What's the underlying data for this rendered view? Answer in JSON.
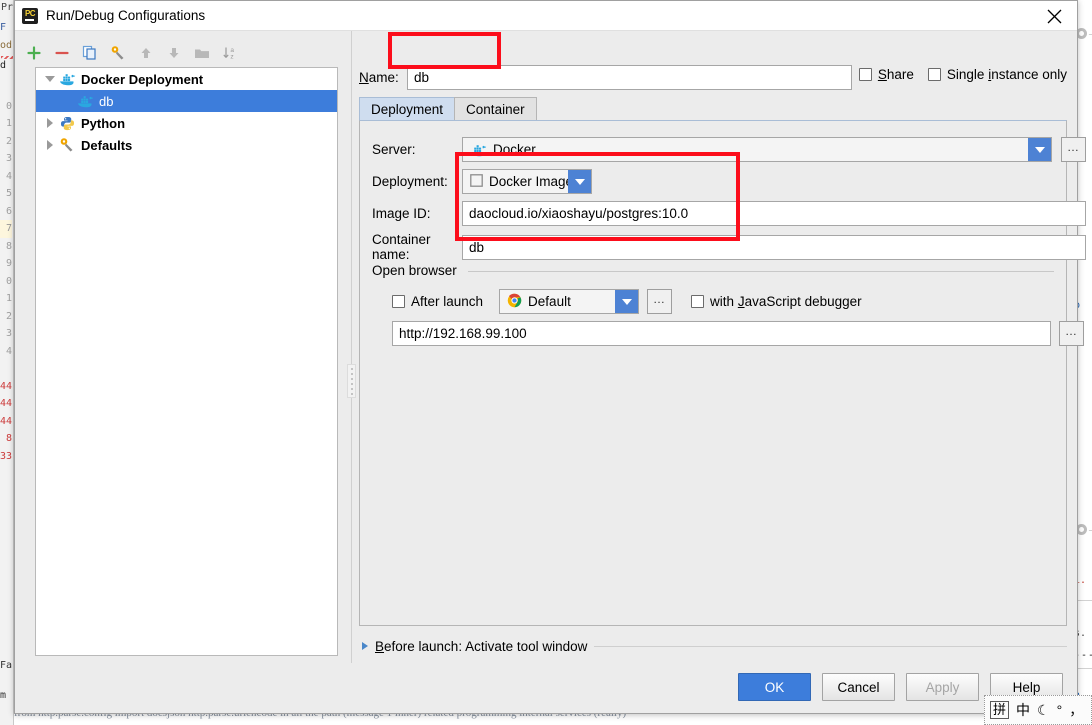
{
  "window": {
    "title": "Run/Debug Configurations",
    "app_icon": "pycharm-icon",
    "close_icon": "close-icon"
  },
  "toolbar": {
    "buttons": [
      {
        "name": "add-configuration",
        "icon": "plus-icon",
        "label": "+"
      },
      {
        "name": "remove-configuration",
        "icon": "minus-icon",
        "label": "−"
      },
      {
        "name": "copy-configuration",
        "icon": "copy-icon",
        "label": ""
      },
      {
        "name": "edit-templates",
        "icon": "wrench-icon",
        "label": ""
      },
      {
        "name": "move-up",
        "icon": "arrow-up-icon",
        "label": ""
      },
      {
        "name": "move-down",
        "icon": "arrow-down-icon",
        "label": ""
      },
      {
        "name": "move-into-folder",
        "icon": "folder-icon",
        "label": ""
      },
      {
        "name": "sort-configurations",
        "icon": "sort-az-icon",
        "label": ""
      }
    ]
  },
  "tree": {
    "items": [
      {
        "label": "Docker Deployment",
        "icon": "docker-icon",
        "expanded": true,
        "depth": 0,
        "selected": false,
        "twisty": "down"
      },
      {
        "label": "db",
        "icon": "docker-icon",
        "expanded": false,
        "depth": 1,
        "selected": true,
        "twisty": "none"
      },
      {
        "label": "Python",
        "icon": "python-icon",
        "expanded": false,
        "depth": 0,
        "selected": false,
        "twisty": "right"
      },
      {
        "label": "Defaults",
        "icon": "wrench-icon",
        "expanded": false,
        "depth": 0,
        "selected": false,
        "twisty": "right"
      }
    ]
  },
  "form": {
    "name_label": "Name:",
    "name_label_mnemonic": "N",
    "name_value": "db",
    "share": {
      "label": "Share",
      "mnemonic": "S",
      "checked": false
    },
    "single_instance": {
      "label": "Single instance only",
      "mnemonic": "i",
      "checked": false
    },
    "tabs": [
      {
        "label": "Deployment",
        "active": true
      },
      {
        "label": "Container",
        "active": false
      }
    ],
    "server": {
      "label": "Server:",
      "value": "Docker",
      "icon": "docker-icon",
      "dropdown_icon": "chevron-down-icon",
      "browse_label": "…"
    },
    "deployment": {
      "label": "Deployment:",
      "value": "Docker Image",
      "icon": "image-icon",
      "dropdown_icon": "chevron-down-icon"
    },
    "image_id": {
      "label": "Image ID:",
      "value": "daocloud.io/xiaoshayu/postgres:10.0"
    },
    "container_name": {
      "label": "Container name:",
      "value": "db"
    },
    "open_browser": {
      "group_label": "Open browser",
      "after_launch": {
        "label": "After launch",
        "checked": false
      },
      "browser": {
        "value": "Default",
        "icon": "chrome-icon",
        "dropdown_icon": "chevron-down-icon",
        "browse_label": "…"
      },
      "js_debugger": {
        "label": "with JavaScript debugger",
        "mnemonic": "J",
        "checked": false
      },
      "url": {
        "value": "http://192.168.99.100",
        "browse_label": "…"
      }
    },
    "before_launch": {
      "label": "Before launch: Activate tool window",
      "mnemonic": "B",
      "expand_icon": "chevron-right-icon"
    }
  },
  "footer": {
    "ok": "OK",
    "cancel": "Cancel",
    "apply": "Apply",
    "help": "Help",
    "apply_disabled": true
  },
  "annotations": {
    "accent_color": "#fc0d1b",
    "boxes": [
      {
        "name": "annotation-name-field"
      },
      {
        "name": "annotation-image-fields"
      }
    ]
  },
  "ime": {
    "mode_key": "拼",
    "lang": "中",
    "moon": "☾",
    "degree": "°",
    "comma": "，"
  },
  "background": {
    "line_numbers": [
      "",
      "",
      "0",
      "1",
      "2",
      "3",
      "4",
      "5",
      "6",
      "7",
      "8",
      "9",
      "0",
      "1",
      "2",
      "3",
      "4",
      "",
      "44",
      "44",
      "44",
      "8",
      "33"
    ],
    "bottom_text": "from http.parse.config import docsjson http.parse.urlencode in all the path (message 1 inner) related programming internal services (really)",
    "right_fragments": [
      "b",
      "i.",
      "s.",
      "n"
    ]
  }
}
